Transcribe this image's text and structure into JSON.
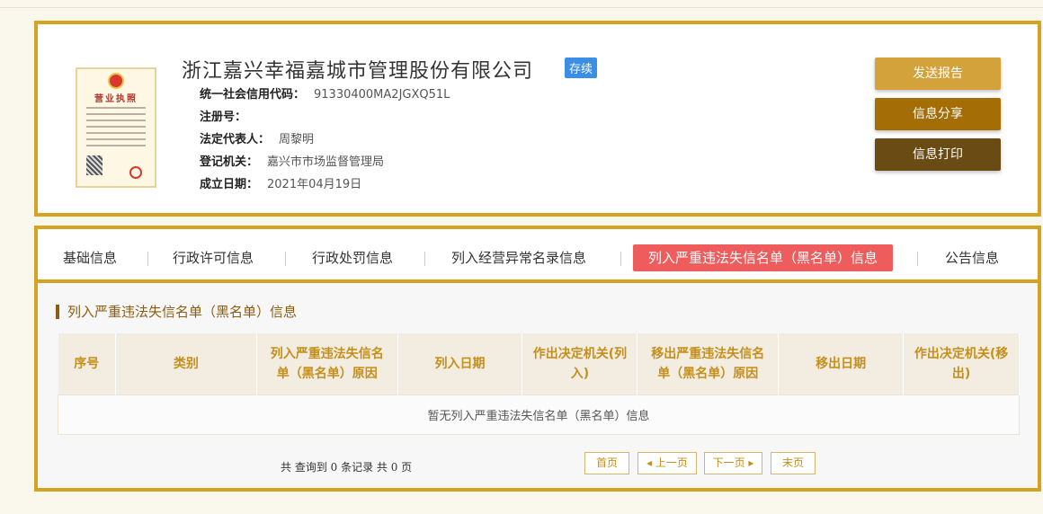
{
  "company": {
    "name": "浙江嘉兴幸福嘉城市管理股份有限公司",
    "status": "存续",
    "license_image_title": "营业执照",
    "fields": [
      {
        "label": "统一社会信用代码：",
        "value": "91330400MA2JGXQ51L"
      },
      {
        "label": "注册号：",
        "value": ""
      },
      {
        "label": "法定代表人：",
        "value": "周黎明"
      },
      {
        "label": "登记机关：",
        "value": "嘉兴市市场监督管理局"
      },
      {
        "label": "成立日期：",
        "value": "2021年04月19日"
      }
    ]
  },
  "actions": {
    "send_report": "发送报告",
    "share": "信息分享",
    "print": "信息打印"
  },
  "tabs": [
    {
      "label": "基础信息",
      "active": false
    },
    {
      "label": "行政许可信息",
      "active": false
    },
    {
      "label": "行政处罚信息",
      "active": false
    },
    {
      "label": "列入经营异常名录信息",
      "active": false
    },
    {
      "label": "列入严重违法失信名单（黑名单）信息",
      "active": true
    },
    {
      "label": "公告信息",
      "active": false
    }
  ],
  "section": {
    "title": "列入严重违法失信名单（黑名单）信息",
    "columns": [
      "序号",
      "类别",
      "列入严重违法失信名单（黑名单）原因",
      "列入日期",
      "作出决定机关(列入)",
      "移出严重违法失信名单（黑名单）原因",
      "移出日期",
      "作出决定机关(移出)"
    ],
    "empty_message": "暂无列入严重违法失信名单（黑名单）信息"
  },
  "pagination": {
    "record_count": "共 查询到 0 条记录 共 0 页",
    "first": "首页",
    "prev": "◂ 上一页",
    "next": "下一页 ▸",
    "last": "末页"
  },
  "colors": {
    "border_gold": "#d4a321",
    "active_tab": "#ef5c5c",
    "status_blue": "#3b8ee6",
    "btn_send": "#d4a23a",
    "btn_share": "#a46d05",
    "btn_print": "#6a4b14"
  }
}
